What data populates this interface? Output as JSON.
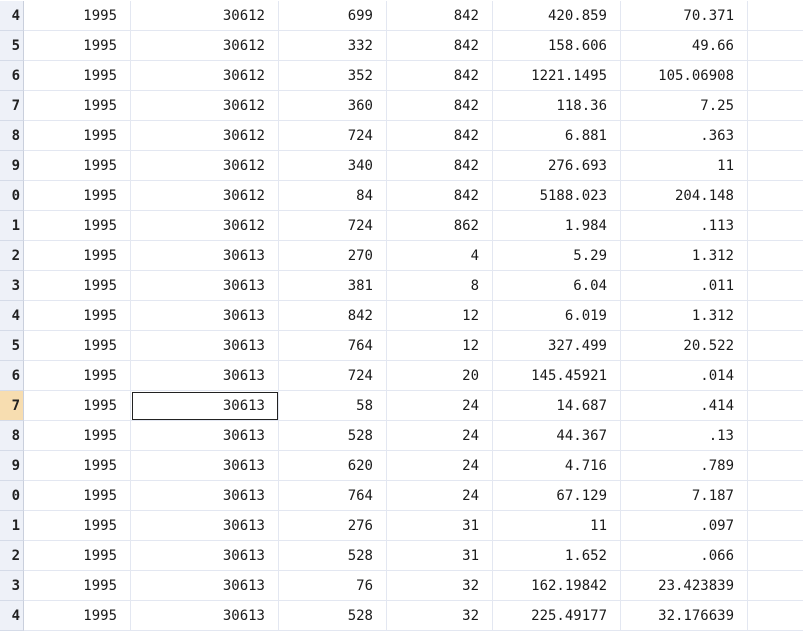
{
  "rows": [
    {
      "n": "4",
      "c": [
        "1995",
        "30612",
        "699",
        "842",
        "420.859",
        "70.371"
      ]
    },
    {
      "n": "5",
      "c": [
        "1995",
        "30612",
        "332",
        "842",
        "158.606",
        "49.66"
      ]
    },
    {
      "n": "6",
      "c": [
        "1995",
        "30612",
        "352",
        "842",
        "1221.1495",
        "105.06908"
      ]
    },
    {
      "n": "7",
      "c": [
        "1995",
        "30612",
        "360",
        "842",
        "118.36",
        "7.25"
      ]
    },
    {
      "n": "8",
      "c": [
        "1995",
        "30612",
        "724",
        "842",
        "6.881",
        ".363"
      ]
    },
    {
      "n": "9",
      "c": [
        "1995",
        "30612",
        "340",
        "842",
        "276.693",
        "11"
      ]
    },
    {
      "n": "0",
      "c": [
        "1995",
        "30612",
        "84",
        "842",
        "5188.023",
        "204.148"
      ]
    },
    {
      "n": "1",
      "c": [
        "1995",
        "30612",
        "724",
        "862",
        "1.984",
        ".113"
      ]
    },
    {
      "n": "2",
      "c": [
        "1995",
        "30613",
        "270",
        "4",
        "5.29",
        "1.312"
      ]
    },
    {
      "n": "3",
      "c": [
        "1995",
        "30613",
        "381",
        "8",
        "6.04",
        ".011"
      ]
    },
    {
      "n": "4",
      "c": [
        "1995",
        "30613",
        "842",
        "12",
        "6.019",
        "1.312"
      ]
    },
    {
      "n": "5",
      "c": [
        "1995",
        "30613",
        "764",
        "12",
        "327.499",
        "20.522"
      ]
    },
    {
      "n": "6",
      "c": [
        "1995",
        "30613",
        "724",
        "20",
        "145.45921",
        ".014"
      ]
    },
    {
      "n": "7",
      "c": [
        "1995",
        "30613",
        "58",
        "24",
        "14.687",
        ".414"
      ]
    },
    {
      "n": "8",
      "c": [
        "1995",
        "30613",
        "528",
        "24",
        "44.367",
        ".13"
      ]
    },
    {
      "n": "9",
      "c": [
        "1995",
        "30613",
        "620",
        "24",
        "4.716",
        ".789"
      ]
    },
    {
      "n": "0",
      "c": [
        "1995",
        "30613",
        "764",
        "24",
        "67.129",
        "7.187"
      ]
    },
    {
      "n": "1",
      "c": [
        "1995",
        "30613",
        "276",
        "31",
        "11",
        ".097"
      ]
    },
    {
      "n": "2",
      "c": [
        "1995",
        "30613",
        "528",
        "31",
        "1.652",
        ".066"
      ]
    },
    {
      "n": "3",
      "c": [
        "1995",
        "30613",
        "76",
        "32",
        "162.19842",
        "23.423839"
      ]
    },
    {
      "n": "4",
      "c": [
        "1995",
        "30613",
        "528",
        "32",
        "225.49177",
        "32.176639"
      ]
    }
  ],
  "selection": {
    "row": 13,
    "col": 1
  },
  "colors": {
    "gridline": "#e3e7f1",
    "row_header_bg": "#eef1f8",
    "active_row_header": "#f7ddb0"
  }
}
